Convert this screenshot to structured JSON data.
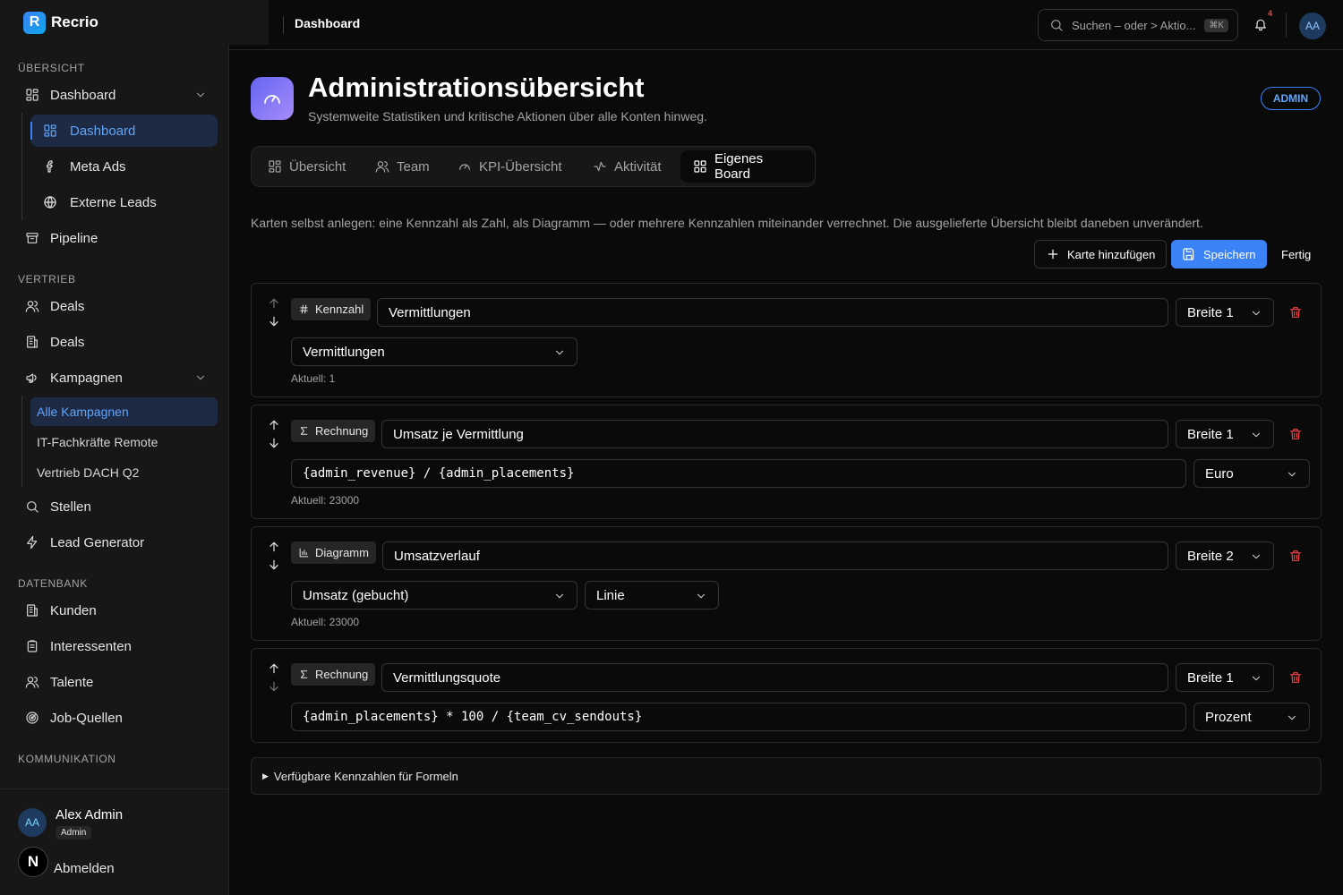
{
  "app": {
    "name": "Recrio",
    "logo_letter": "R"
  },
  "sidebar": {
    "sections": {
      "overview": "ÜBERSICHT",
      "sales": "VERTRIEB",
      "database": "DATENBANK",
      "communication": "KOMMUNIKATION"
    },
    "dashboard_group": "Dashboard",
    "dashboard_sub": [
      "Dashboard",
      "Meta Ads",
      "Externe Leads"
    ],
    "pipeline": "Pipeline",
    "deals1": "Deals",
    "deals2": "Deals",
    "campaigns": "Kampagnen",
    "campaign_sub": [
      "Alle Kampagnen",
      "IT-Fachkräfte Remote",
      "Vertrieb DACH Q2"
    ],
    "jobs": "Stellen",
    "lead_generator": "Lead Generator",
    "customers": "Kunden",
    "prospects": "Interessenten",
    "talents": "Talente",
    "job_sources": "Job-Quellen",
    "user": {
      "initials": "AA",
      "name": "Alex Admin",
      "role": "Admin",
      "logout": "Abmelden",
      "badge_letter": "N"
    }
  },
  "topbar": {
    "breadcrumb": "Dashboard",
    "search_placeholder": "Suchen – oder > Aktio...",
    "search_shortcut": "⌘K",
    "notif_count": "4",
    "avatar": "AA"
  },
  "page": {
    "title": "Administrationsübersicht",
    "subtitle": "Systemweite Statistiken und kritische Aktionen über alle Konten hinweg.",
    "role_badge": "ADMIN",
    "tabs": [
      "Übersicht",
      "Team",
      "KPI-Übersicht",
      "Aktivität",
      "Eigenes Board"
    ],
    "active_tab": "Eigenes Board",
    "description": "Karten selbst anlegen: eine Kennzahl als Zahl, als Diagramm — oder mehrere Kennzahlen miteinander verrechnet. Die ausgelieferte Übersicht bleibt daneben unverändert.",
    "buttons": {
      "add_card": "Karte hinzufügen",
      "save": "Speichern",
      "done": "Fertig"
    }
  },
  "cards": [
    {
      "type": "Kennzahl",
      "title": "Vermittlungen",
      "width": "Breite 1",
      "metric": "Vermittlungen",
      "current": "Aktuell: 1"
    },
    {
      "type": "Rechnung",
      "title": "Umsatz je Vermittlung",
      "width": "Breite 1",
      "formula": "{admin_revenue} / {admin_placements}",
      "unit": "Euro",
      "current": "Aktuell: 23000"
    },
    {
      "type": "Diagramm",
      "title": "Umsatzverlauf",
      "width": "Breite 2",
      "metric": "Umsatz (gebucht)",
      "chart_type": "Linie",
      "current": "Aktuell: 23000"
    },
    {
      "type": "Rechnung",
      "title": "Vermittlungsquote",
      "width": "Breite 1",
      "formula": "{admin_placements} * 100 / {team_cv_sendouts}",
      "unit": "Prozent"
    }
  ],
  "available_metrics_label": "Verfügbare Kennzahlen für Formeln",
  "colors": {
    "accent": "#3b82f6",
    "danger": "#ef4444",
    "background": "#0a0a0a",
    "sidebar": "#171717"
  }
}
